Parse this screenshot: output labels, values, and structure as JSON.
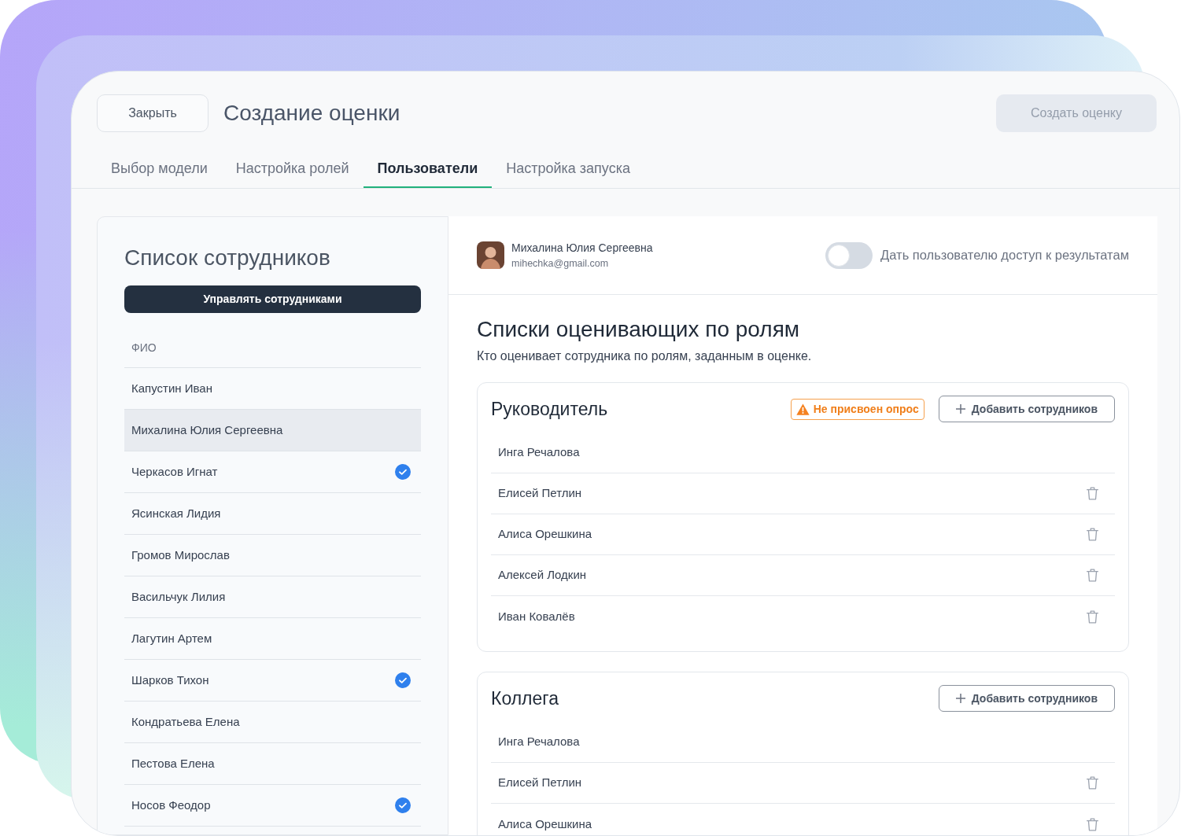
{
  "window": {
    "close_button": "Закрыть",
    "title": "Создание оценки",
    "create_button": {
      "label": "Создать оценку",
      "disabled": true
    }
  },
  "tabs": [
    {
      "label": "Выбор модели",
      "selected": false
    },
    {
      "label": "Настройка ролей",
      "selected": false
    },
    {
      "label": "Пользователи",
      "selected": true
    },
    {
      "label": "Настройка запуска",
      "selected": false
    }
  ],
  "employee_list": {
    "title": "Список сотрудников",
    "manage_button": "Управлять сотрудниками",
    "column": "ФИО",
    "rows": [
      {
        "name": "Капустин Иван",
        "selected": false,
        "checked": false
      },
      {
        "name": "Михалина Юлия Сергеевна",
        "selected": true,
        "checked": false
      },
      {
        "name": "Черкасов Игнат",
        "selected": false,
        "checked": true
      },
      {
        "name": "Ясинская Лидия",
        "selected": false,
        "checked": false
      },
      {
        "name": "Громов Мирослав",
        "selected": false,
        "checked": false
      },
      {
        "name": "Васильчук Лилия",
        "selected": false,
        "checked": false
      },
      {
        "name": "Лагутин Артем",
        "selected": false,
        "checked": false
      },
      {
        "name": "Шарков Тихон",
        "selected": false,
        "checked": true
      },
      {
        "name": "Кондратьева Елена",
        "selected": false,
        "checked": false
      },
      {
        "name": "Пестова Елена",
        "selected": false,
        "checked": false
      },
      {
        "name": "Носов Феодор",
        "selected": false,
        "checked": true
      }
    ]
  },
  "user": {
    "name": "Михалина Юлия Сергеевна",
    "email": "mihechka@gmail.com"
  },
  "access_toggle": {
    "label": "Дать пользователю доступ к результатам",
    "on": false
  },
  "evaluators": {
    "title": "Списки оценивающих по ролям",
    "subtitle": "Кто оценивает сотрудника по ролям, заданным в оценке.",
    "roles": [
      {
        "title": "Руководитель",
        "warning": "Не присвоен опрос",
        "add_button": "Добавить сотрудников",
        "members": [
          {
            "name": "Инга Речалова",
            "removable": false
          },
          {
            "name": "Елисей Петлин",
            "removable": true
          },
          {
            "name": "Алиса Орешкина",
            "removable": true
          },
          {
            "name": "Алексей Лодкин",
            "removable": true
          },
          {
            "name": "Иван Ковалёв",
            "removable": true
          }
        ]
      },
      {
        "title": "Коллега",
        "add_button": "Добавить сотрудников",
        "members": [
          {
            "name": "Инга Речалова",
            "removable": false
          },
          {
            "name": "Елисей Петлин",
            "removable": true
          },
          {
            "name": "Алиса Орешкина",
            "removable": true
          }
        ]
      }
    ]
  }
}
